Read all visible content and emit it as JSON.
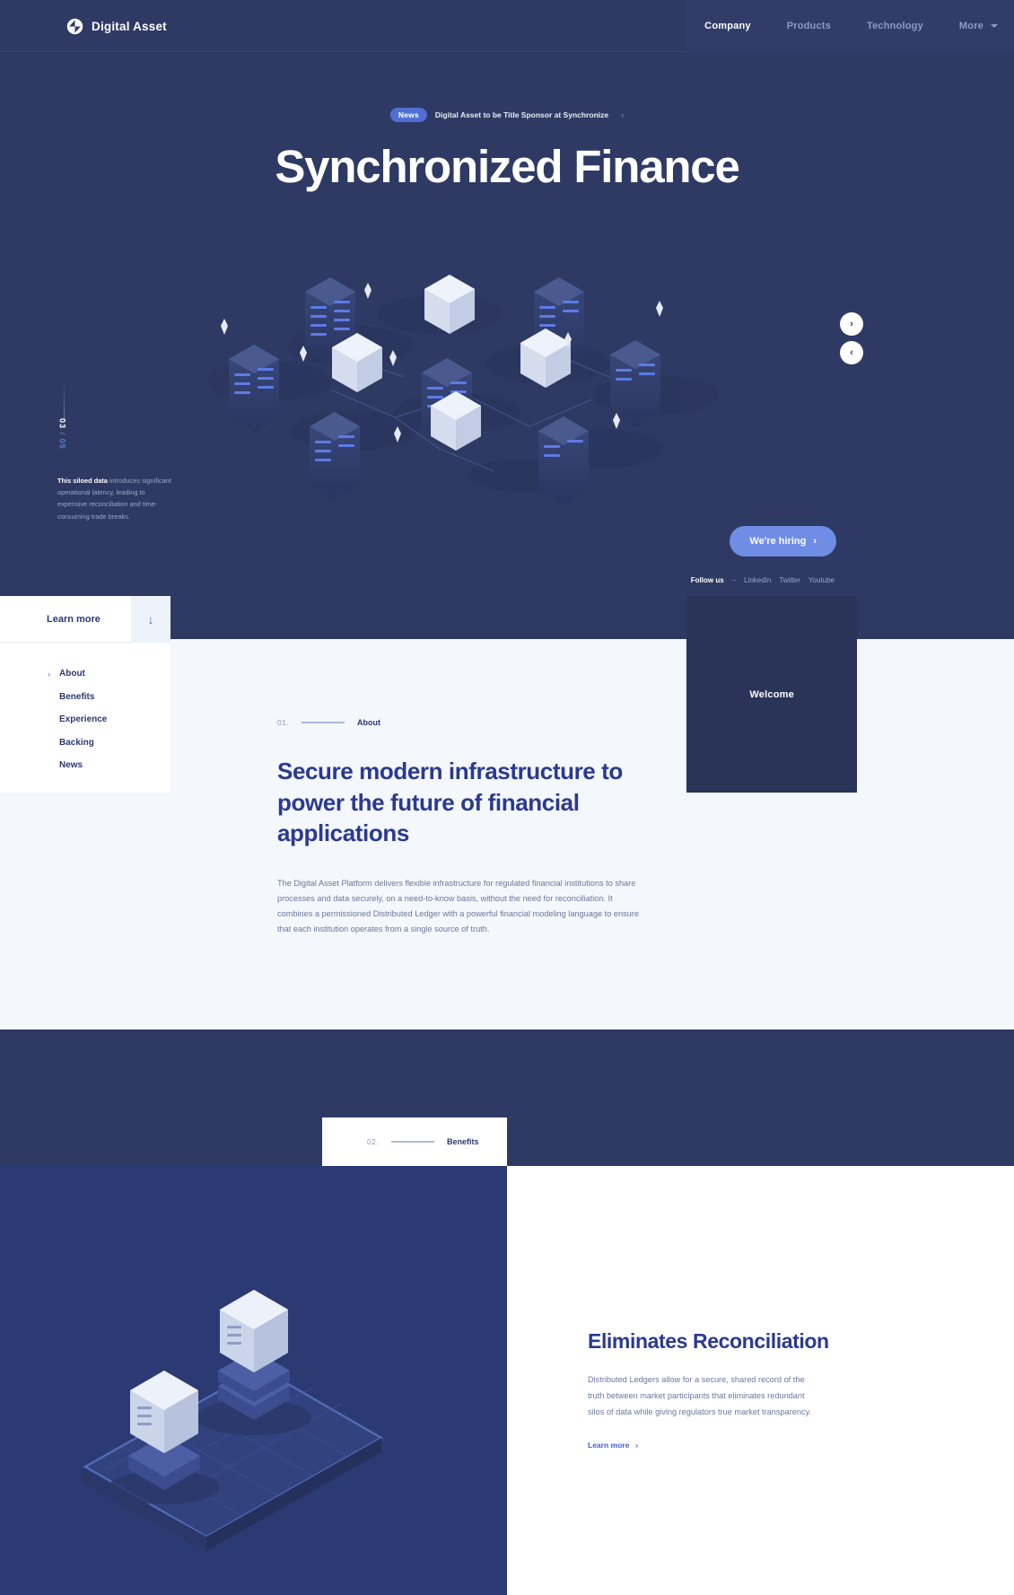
{
  "brand": {
    "name": "Digital Asset",
    "logo_icon": "diamond-logo-icon"
  },
  "nav": {
    "items": [
      {
        "label": "Welcome",
        "state": "active"
      },
      {
        "label": "Company",
        "state": "active"
      },
      {
        "label": "Products",
        "state": "muted"
      },
      {
        "label": "Technology",
        "state": "muted"
      },
      {
        "label": "More",
        "state": "muted"
      }
    ]
  },
  "hero": {
    "news": {
      "badge": "News",
      "text": "Digital Asset to be Title Sponsor at Synchronize",
      "arrow": "›"
    },
    "title": "Synchronized Finance",
    "counter": {
      "current": "03",
      "separator": "/",
      "total": "05"
    },
    "caption_strong": "This siloed data",
    "caption_rest": " introduces significant operational latency, leading to expensive reconciliation and time-consuming trade breaks.",
    "hiring_label": "We're hiring",
    "hiring_arrow": "›",
    "follow_label": "Follow us",
    "follow_dash": "–",
    "socials": [
      "LinkedIn",
      "Twitter",
      "Youtube"
    ],
    "carousel": {
      "next": "›",
      "prev": "‹"
    }
  },
  "panel": {
    "learn_more": "Learn more",
    "down_arrow": "↓",
    "items": [
      {
        "label": "About",
        "chevron": "›"
      },
      {
        "label": "Benefits",
        "chevron": ""
      },
      {
        "label": "Experience",
        "chevron": ""
      },
      {
        "label": "Backing",
        "chevron": ""
      },
      {
        "label": "News",
        "chevron": ""
      }
    ]
  },
  "about": {
    "marker_num": "01.",
    "marker_name": "About",
    "heading": "Secure modern infrastructure to power the future of financial applications",
    "body": "The Digital Asset Platform delivers flexible infrastructure for regulated financial institutions to share processes and data securely, on a need-to-know basis, without the need for reconciliation. It combines a permissioned Distributed Ledger with a powerful financial modeling language to ensure that each institution operates from a single source of truth."
  },
  "benefits": {
    "marker_num": "02.",
    "marker_name": "Benefits",
    "heading": "Eliminates Reconciliation",
    "body": "Distributed Ledgers allow for a secure, shared record of the truth between market participants that eliminates redundant silos of data while giving regulators true market transparency.",
    "link_label": "Learn more",
    "link_arrow": "›"
  },
  "colors": {
    "hero_bg": "#2e3a63",
    "section_bg": "#f4f7fc",
    "deep_navy": "#2b3a72",
    "accent_blue": "#4f6fd4",
    "button_blue": "#6f8de4",
    "heading_blue": "#2b3a8e"
  }
}
